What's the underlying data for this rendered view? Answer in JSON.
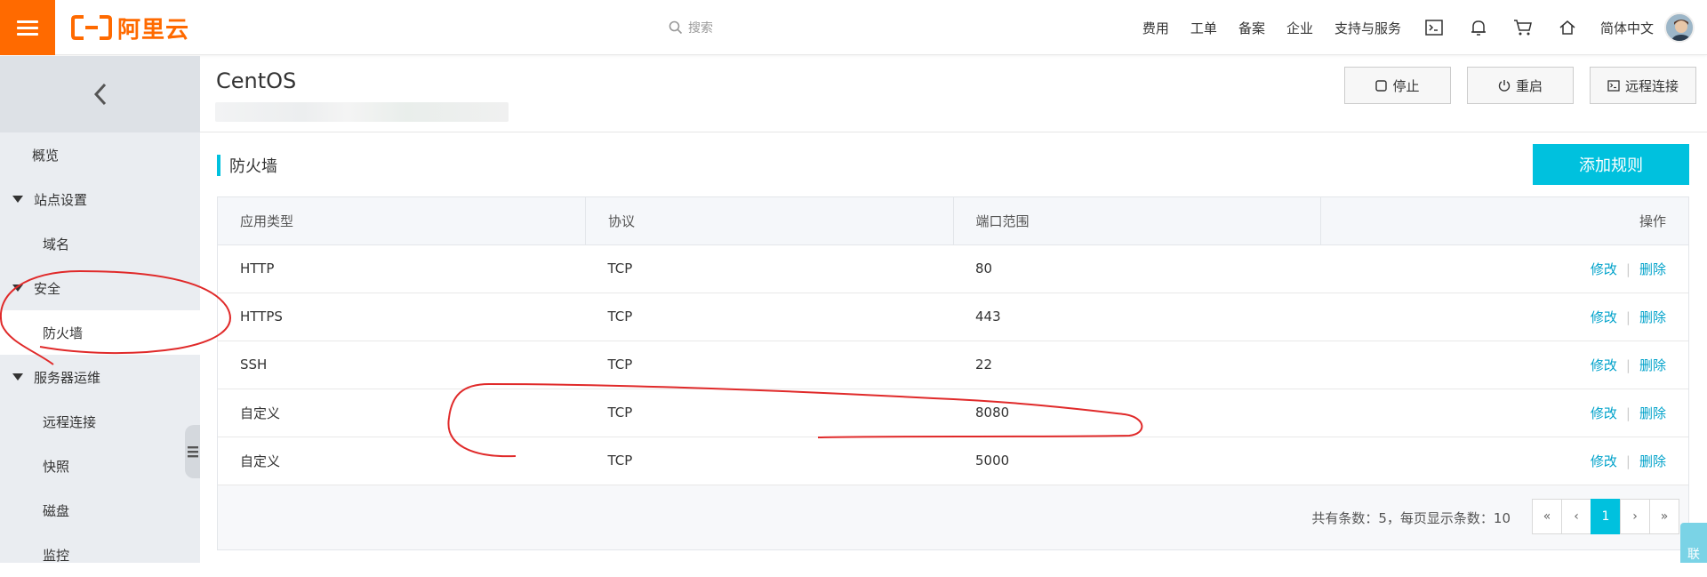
{
  "topbar": {
    "logo_text": "阿里云",
    "search_placeholder": "搜索",
    "nav": [
      "费用",
      "工单",
      "备案",
      "企业",
      "支持与服务"
    ],
    "language": "简体中文",
    "icons": [
      "terminal-icon",
      "bell-icon",
      "cart-icon",
      "home-icon"
    ],
    "brand_color": "#ff6a00"
  },
  "sidebar": {
    "overview": "概览",
    "group_site": "站点设置",
    "domain": "域名",
    "group_security": "安全",
    "firewall": "防火墙",
    "group_ops": "服务器运维",
    "remote": "远程连接",
    "snapshot": "快照",
    "disk": "磁盘",
    "monitor": "监控"
  },
  "header": {
    "title": "CentOS",
    "stop_label": "停止",
    "restart_label": "重启",
    "remote_label": "远程连接"
  },
  "section": {
    "title": "防火墙",
    "add_button": "添加规则",
    "accent_color": "#00c1de"
  },
  "table": {
    "columns": [
      "应用类型",
      "协议",
      "端口范围",
      "操作"
    ],
    "rows": [
      {
        "app": "HTTP",
        "protocol": "TCP",
        "port": "80"
      },
      {
        "app": "HTTPS",
        "protocol": "TCP",
        "port": "443"
      },
      {
        "app": "SSH",
        "protocol": "TCP",
        "port": "22"
      },
      {
        "app": "自定义",
        "protocol": "TCP",
        "port": "8080"
      },
      {
        "app": "自定义",
        "protocol": "TCP",
        "port": "5000"
      }
    ],
    "edit_label": "修改",
    "delete_label": "删除",
    "separator": "|"
  },
  "pagination": {
    "summary": "共有条数：5，每页显示条数：10",
    "first": "«",
    "prev": "‹",
    "current": "1",
    "next": "›",
    "last": "»"
  },
  "widget": {
    "label": "联"
  }
}
